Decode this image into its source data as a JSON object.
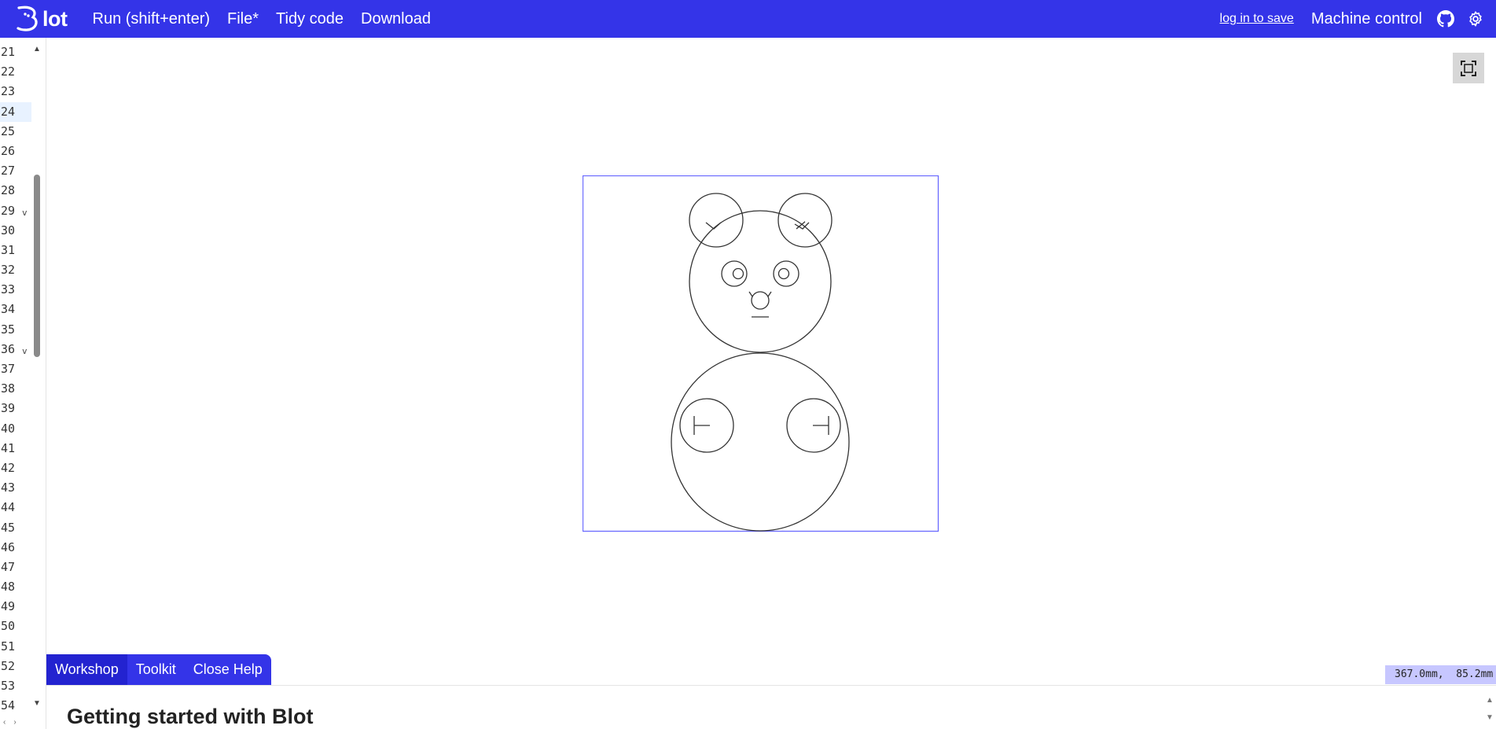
{
  "app": {
    "logo_text": "lot",
    "colors": {
      "accent": "#3434e8",
      "coord_bg": "#c7c7ff",
      "frame": "#6a6aff"
    }
  },
  "topbar": {
    "run_label": "Run (shift+enter)",
    "file_label": "File*",
    "tidy_label": "Tidy code",
    "download_label": "Download",
    "login_label": "log in to save",
    "machine_label": "Machine control",
    "github_icon": "github-icon",
    "settings_icon": "gear-icon"
  },
  "editor": {
    "line_numbers": [
      "21",
      "22",
      "23",
      "24",
      "25",
      "26",
      "27",
      "28",
      "29",
      "30",
      "31",
      "32",
      "33",
      "34",
      "35",
      "36",
      "37",
      "38",
      "39",
      "40",
      "41",
      "42",
      "43",
      "44",
      "45",
      "46",
      "47",
      "48",
      "49",
      "50",
      "51",
      "52",
      "53",
      "54"
    ],
    "active_line": "24",
    "fold_lines": [
      "29",
      "36"
    ]
  },
  "viewer": {
    "fit_icon": "fit-to-screen-icon"
  },
  "help": {
    "tabs": [
      "Workshop",
      "Toolkit",
      "Close Help"
    ],
    "active_tab": "Workshop",
    "heading": "Getting started with Blot"
  },
  "status": {
    "coords": "367.0mm,  85.2mm"
  }
}
